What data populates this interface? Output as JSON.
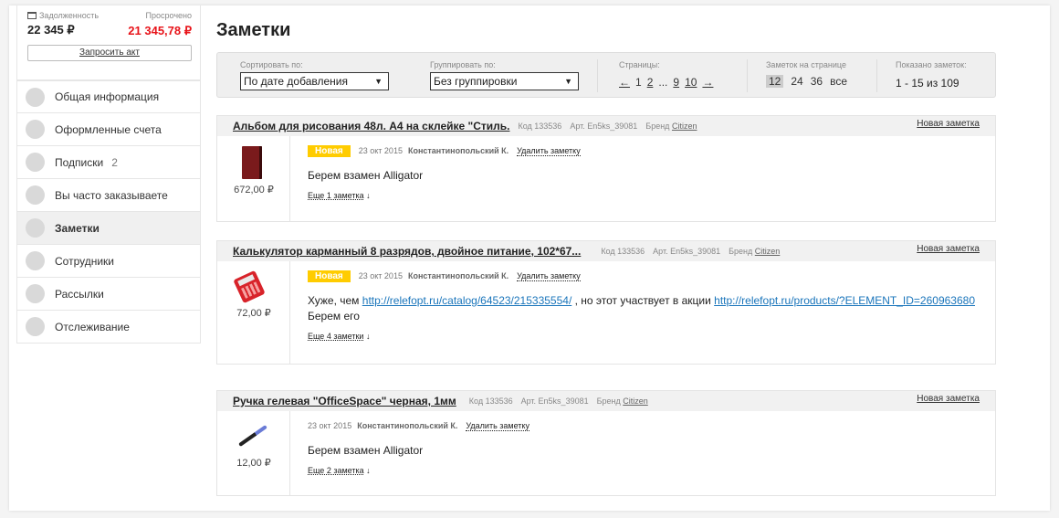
{
  "sidebar": {
    "debt_label": "Задолженность",
    "debt_value": "22 345 ₽",
    "overdue_label": "Просрочено",
    "overdue_value": "21 345,78 ₽",
    "act_button": "Запросить акт",
    "items": [
      {
        "label": "Общая информация",
        "count": ""
      },
      {
        "label": "Оформленные счета",
        "count": ""
      },
      {
        "label": "Подписки",
        "count": "2"
      },
      {
        "label": "Вы часто заказываете",
        "count": ""
      },
      {
        "label": "Заметки",
        "count": "",
        "active": true
      },
      {
        "label": "Сотрудники",
        "count": ""
      },
      {
        "label": "Рассылки",
        "count": ""
      },
      {
        "label": "Отслеживание",
        "count": ""
      }
    ]
  },
  "main": {
    "title": "Заметки",
    "toolbar": {
      "sort_label": "Сортировать по:",
      "sort_value": "По дате добавления",
      "group_label": "Группировать по:",
      "group_value": "Без группировки",
      "pages_label": "Страницы:",
      "prev_arrow": "←",
      "pages": [
        "1",
        "2",
        "...",
        "9",
        "10"
      ],
      "next_arrow": "→",
      "per_page_label": "Заметок на странице",
      "per_page_options": [
        "12",
        "24",
        "36",
        "все"
      ],
      "per_page_selected": "12",
      "shown_label": "Показано заметок:",
      "shown_value": "1 - 15 из 109"
    },
    "new_note_label": "Новая заметка",
    "delete_label": "Удалить заметку",
    "brand_label": "Бренд",
    "notes": [
      {
        "product": "Альбом для рисования 48л. А4 на склейке \"Стиль.",
        "code": "Код 133536",
        "art": "Арт. En5ks_39081",
        "brand": "Citizen",
        "price": "672,00 ₽",
        "badge": "Новая",
        "date": "23 окт 2015",
        "author": "Константинопольский К.",
        "text_1": "Берем взамен Alligator",
        "more": "Еще 1 заметка"
      },
      {
        "product": "Калькулятор карманный 8 разрядов, двойное питание, 102*67...",
        "code": "Код 133536",
        "art": "Арт. En5ks_39081",
        "brand": "Citizen",
        "price": "72,00 ₽",
        "badge": "Новая",
        "date": "23 окт 2015",
        "author": "Константинопольский К.",
        "text_1": "Хуже, чем",
        "link_1": "http://relefopt.ru/catalog/64523/215335554/",
        "text_2": ", но этот участвует в акции",
        "link_2": "http://relefopt.ru/products/?ELEMENT_ID=260963680",
        "text_3": "Берем его",
        "more": "Еще 4 заметки"
      },
      {
        "product": "Ручка гелевая \"OfficeSpace\" черная, 1мм",
        "code": "Код 133536",
        "art": "Арт. En5ks_39081",
        "brand": "Citizen",
        "price": "12,00 ₽",
        "badge": "",
        "date": "23 окт 2015",
        "author": "Константинопольский К.",
        "text_1": "Берем взамен Alligator",
        "more": "Еще 2 заметка"
      }
    ],
    "more_arrow": "↓"
  }
}
